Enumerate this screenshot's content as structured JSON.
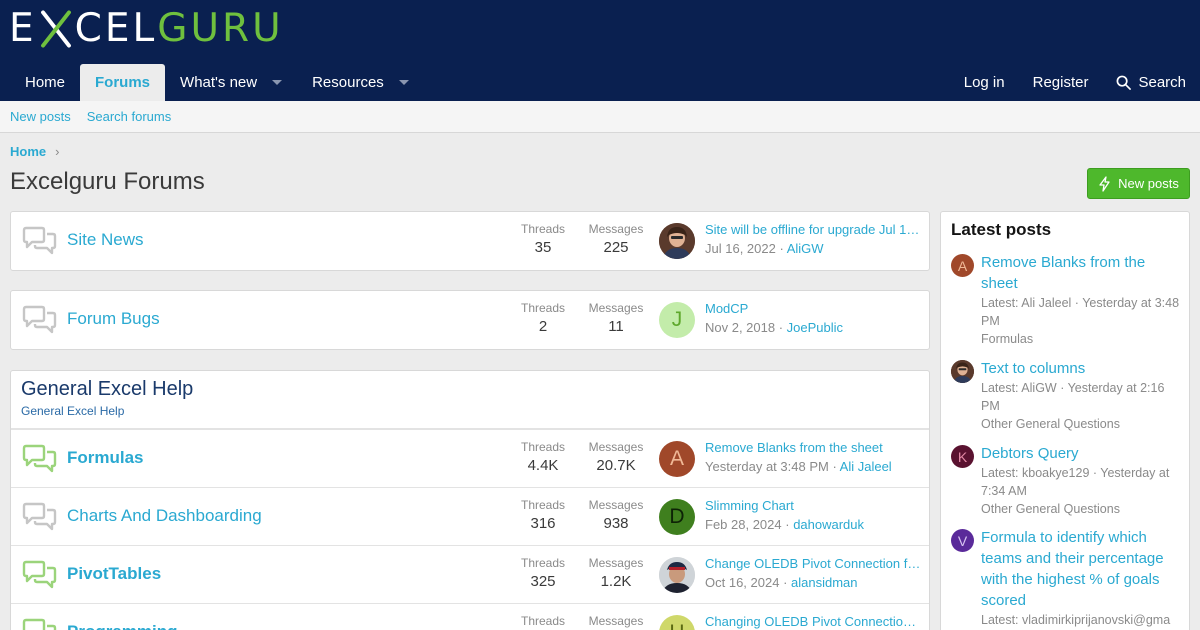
{
  "header": {
    "logo": {
      "part1": "E",
      "part2": "CEL",
      "part3": "GURU"
    },
    "nav": [
      {
        "label": "Home",
        "active": false
      },
      {
        "label": "Forums",
        "active": true
      },
      {
        "label": "What's new",
        "active": false
      },
      {
        "label": "Resources",
        "active": false
      }
    ],
    "login_label": "Log in",
    "register_label": "Register",
    "search_label": "Search"
  },
  "subnav": {
    "new_posts": "New posts",
    "search_forums": "Search forums"
  },
  "breadcrumb": {
    "home": "Home",
    "sep": "›"
  },
  "page": {
    "title": "Excelguru Forums",
    "new_posts_button": "New posts"
  },
  "labels": {
    "threads": "Threads",
    "messages": "Messages"
  },
  "standalone": [
    {
      "title": "Site News",
      "threads": "35",
      "messages": "225",
      "last_title": "Site will be offline for upgrade Jul 13…",
      "last_date": "Jul 16, 2022",
      "last_user": "AliGW",
      "avatar_letter": ""
    },
    {
      "title": "Forum Bugs",
      "threads": "2",
      "messages": "11",
      "last_title": "ModCP",
      "last_date": "Nov 2, 2018",
      "last_user": "JoePublic",
      "avatar_letter": "J"
    }
  ],
  "category": {
    "title": "General Excel Help",
    "description": "General Excel Help",
    "nodes": [
      {
        "title": "Formulas",
        "threads": "4.4K",
        "messages": "20.7K",
        "last_title": "Remove Blanks from the sheet",
        "last_date": "Yesterday at 3:48 PM",
        "last_user": "Ali Jaleel",
        "avatar_letter": "A"
      },
      {
        "title": "Charts And Dashboarding",
        "threads": "316",
        "messages": "938",
        "last_title": "Slimming Chart",
        "last_date": "Feb 28, 2024",
        "last_user": "dahowarduk",
        "avatar_letter": "D"
      },
      {
        "title": "PivotTables",
        "threads": "325",
        "messages": "1.2K",
        "last_title": "Change OLEDB Pivot Connection fr…",
        "last_date": "Oct 16, 2024",
        "last_user": "alansidman",
        "avatar_letter": ""
      },
      {
        "title": "Programming",
        "threads": "",
        "messages": "",
        "last_title": "Changing OLEDB Pivot Connection …",
        "last_date": "",
        "last_user": "",
        "avatar_letter": "H"
      }
    ]
  },
  "sidebar": {
    "title": "Latest posts",
    "posts": [
      {
        "title": "Remove Blanks from the sheet",
        "meta": "Latest: Ali Jaleel · Yesterday at 3:48 PM",
        "forum": "Formulas",
        "avatar_letter": "A"
      },
      {
        "title": "Text to columns",
        "meta": "Latest: AliGW · Yesterday at 2:16 PM",
        "forum": "Other General Questions",
        "avatar_letter": ""
      },
      {
        "title": "Debtors Query",
        "meta": "Latest: kboakye129 · Yesterday at 7:34 AM",
        "forum": "Other General Questions",
        "avatar_letter": "K"
      },
      {
        "title": "Formula to identify which teams and their percentage with the highest % of goals scored",
        "meta": "Latest: vladimirkiprijanovski@gma",
        "forum": "",
        "avatar_letter": "V"
      }
    ]
  },
  "colors": {
    "header_bg": "#0a2050",
    "accent": "#2aa9d1",
    "brand_green": "#6fc03e",
    "button_green": "#4eb82c"
  }
}
